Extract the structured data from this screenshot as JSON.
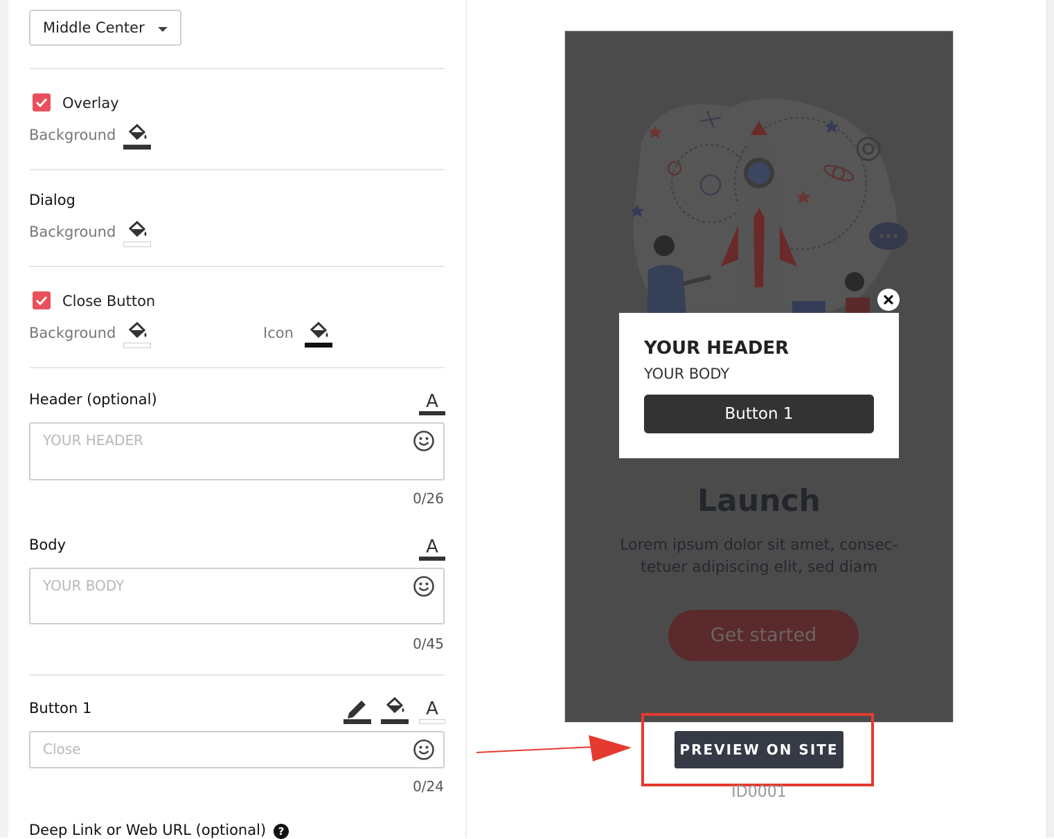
{
  "position": {
    "selected": "Middle Center"
  },
  "overlay": {
    "label": "Overlay",
    "checked": true,
    "background_label": "Background"
  },
  "dialog": {
    "title": "Dialog",
    "background_label": "Background"
  },
  "close_button": {
    "label": "Close Button",
    "checked": true,
    "background_label": "Background",
    "icon_label": "Icon"
  },
  "header": {
    "title": "Header (optional)",
    "placeholder": "YOUR HEADER",
    "counter": "0/26"
  },
  "body": {
    "title": "Body",
    "placeholder": "YOUR BODY",
    "counter": "0/45"
  },
  "button1": {
    "title": "Button 1",
    "placeholder": "Close",
    "counter": "0/24"
  },
  "deep_link": {
    "title": "Deep Link or Web URL (optional)"
  },
  "preview": {
    "dialog_header": "YOUR HEADER",
    "dialog_body": "YOUR BODY",
    "dialog_button": "Button 1",
    "bg_title": "Launch",
    "bg_text_line1": "Lorem ipsum dolor sit amet, consec-",
    "bg_text_line2": "tetuer adipiscing elit, sed diam",
    "bg_button": "Get started",
    "preview_button": "PREVIEW ON SITE",
    "id": "ID0001"
  },
  "colors": {
    "accent": "#e8505b",
    "annotation_red": "#e53a2f",
    "preview_bg": "#4b4b4b",
    "button_dark": "#353a45"
  }
}
